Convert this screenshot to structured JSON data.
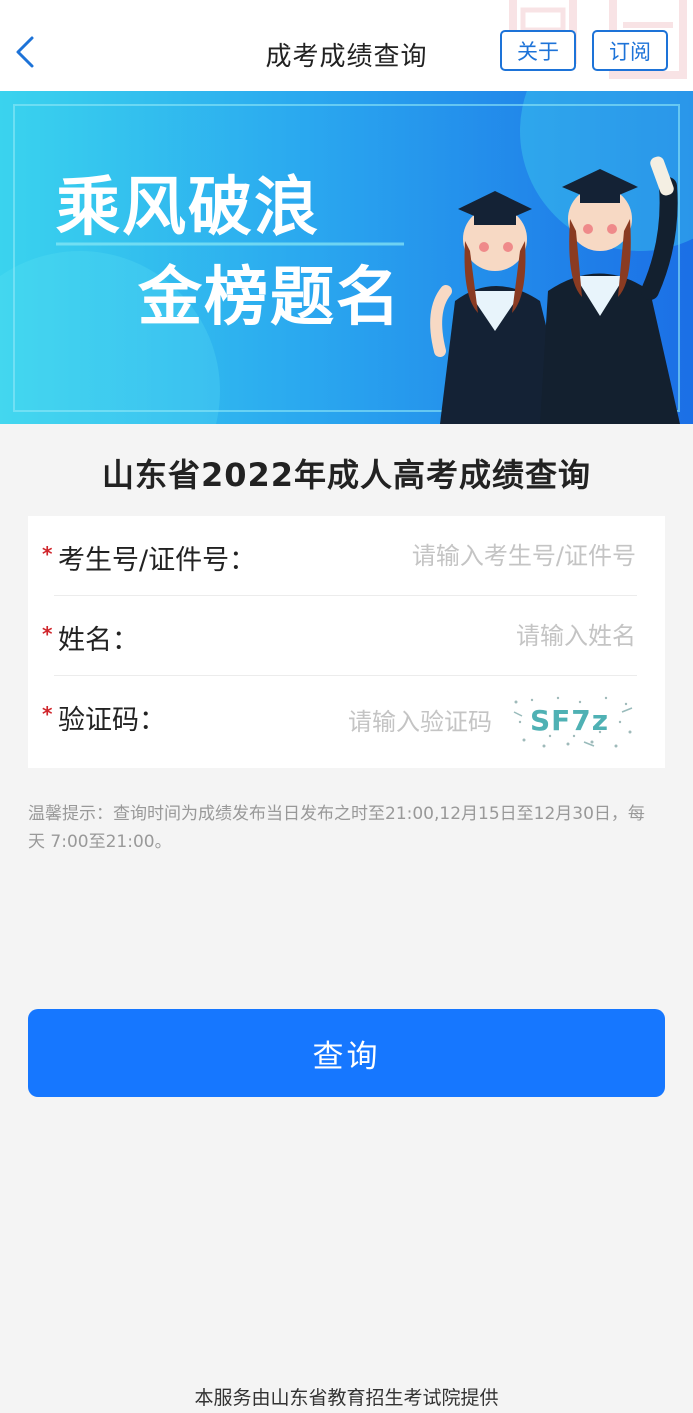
{
  "header": {
    "title": "成考成绩查询",
    "about_label": "关于",
    "subscribe_label": "订阅"
  },
  "banner": {
    "line1": "乘风破浪",
    "line2": "金榜题名"
  },
  "page_heading": "山东省2022年成人高考成绩查询",
  "form": {
    "required_mark": "*",
    "candidate_id": {
      "label": "考生号/证件号：",
      "placeholder": "请输入考生号/证件号",
      "value": ""
    },
    "name": {
      "label": "姓名：",
      "placeholder": "请输入姓名",
      "value": ""
    },
    "captcha": {
      "label": "验证码：",
      "placeholder": "请输入验证码",
      "value": "",
      "image_text": "SF7z"
    }
  },
  "tip": "温馨提示：查询时间为成绩发布当日发布之时至21:00,12月15日至12月30日，每天 7:00至21:00。",
  "query_button": "查询",
  "footer": "本服务由山东省教育招生考试院提供",
  "colors": {
    "accent": "#1677ff",
    "nav_blue": "#1d73d8",
    "required": "#d0262c",
    "banner_blue": "#1b7fe8",
    "banner_cyan": "#37d3ec"
  },
  "icons": {
    "back": "chevron-left-icon"
  }
}
